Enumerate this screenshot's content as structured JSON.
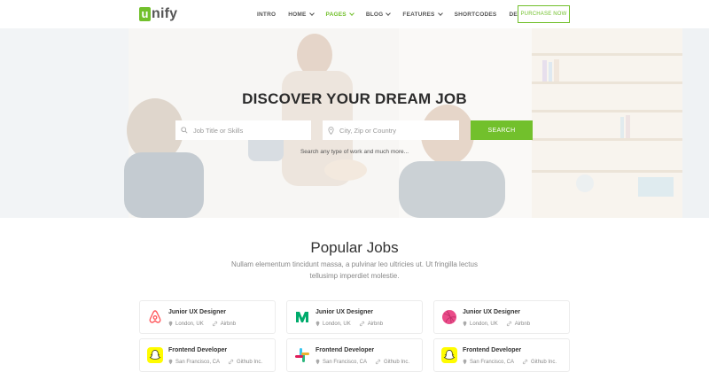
{
  "header": {
    "logo_letter": "u",
    "logo_rest": "nify",
    "nav": [
      {
        "label": "INTRO",
        "dropdown": false,
        "active": false
      },
      {
        "label": "HOME",
        "dropdown": true,
        "active": false
      },
      {
        "label": "PAGES",
        "dropdown": true,
        "active": true
      },
      {
        "label": "BLOG",
        "dropdown": true,
        "active": false
      },
      {
        "label": "FEATURES",
        "dropdown": true,
        "active": false
      },
      {
        "label": "SHORTCODES",
        "dropdown": false,
        "active": false
      },
      {
        "label": "DEMOS",
        "dropdown": true,
        "active": false
      }
    ],
    "purchase_label": "PURCHASE NOW"
  },
  "hero": {
    "title": "DISCOVER YOUR DREAM JOB",
    "job_placeholder": "Job Title or Skills",
    "location_placeholder": "City, Zip or Country",
    "search_label": "SEARCH",
    "subtitle": "Search any type of work and much more..."
  },
  "popular": {
    "title": "Popular Jobs",
    "description": "Nullam elementum tincidunt massa, a pulvinar leo ultricies ut. Ut fringilla lectus tellusimp imperdiet molestie."
  },
  "jobs": [
    {
      "title": "Junior UX Designer",
      "location": "London, UK",
      "company": "Airbnb",
      "logo": "airbnb-icon"
    },
    {
      "title": "Junior UX Designer",
      "location": "London, UK",
      "company": "Airbnb",
      "logo": "medium-icon"
    },
    {
      "title": "Junior UX Designer",
      "location": "London, UK",
      "company": "Airbnb",
      "logo": "dribbble-icon"
    },
    {
      "title": "Frontend Developer",
      "location": "San Francisco, CA",
      "company": "Github Inc.",
      "logo": "snapchat-icon"
    },
    {
      "title": "Frontend Developer",
      "location": "San Francisco, CA",
      "company": "Github Inc.",
      "logo": "slack-icon"
    },
    {
      "title": "Frontend Developer",
      "location": "San Francisco, CA",
      "company": "Github Inc.",
      "logo": "snapchat-icon"
    }
  ],
  "colors": {
    "accent": "#72c02c",
    "airbnb": "#ff5a5f",
    "medium": "#00ab6c",
    "dribbble": "#ea4c89",
    "snapchat": "#fffc00"
  }
}
